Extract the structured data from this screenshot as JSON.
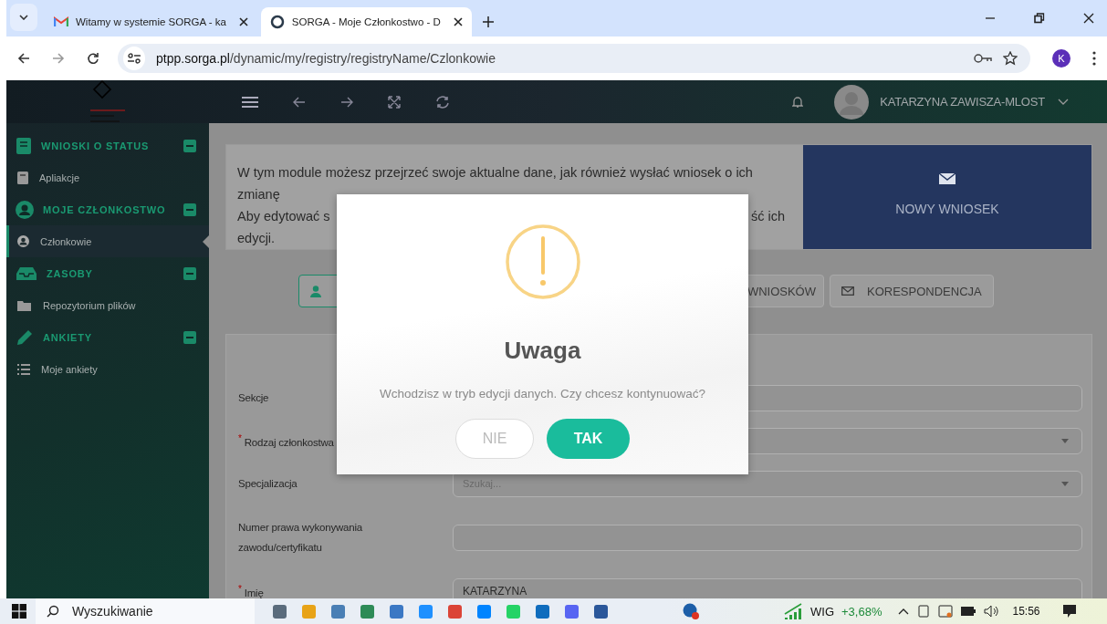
{
  "browser": {
    "tabs": [
      {
        "title": "Witamy w systemie SORGA - ka",
        "selected": false
      },
      {
        "title": "SORGA - Moje Członkostwo - D",
        "selected": true
      }
    ],
    "url_host": "ptpp.sorga.pl",
    "url_path": "/dynamic/my/registry/registryName/Czlonkowie",
    "profile_initial": "K"
  },
  "header": {
    "user_name": "KATARZYNA ZAWISZA-MLOST"
  },
  "sidebar": {
    "groups": [
      {
        "label": "WNIOSKI O STATUS",
        "expanded": true,
        "items": [
          {
            "label": "Apliakcje",
            "selected": false
          }
        ]
      },
      {
        "label": "MOJE CZŁONKOSTWO",
        "expanded": true,
        "items": [
          {
            "label": "Członkowie",
            "selected": true
          }
        ]
      },
      {
        "label": "ZASOBY",
        "expanded": true,
        "items": [
          {
            "label": "Repozytorium plików",
            "selected": false
          }
        ]
      },
      {
        "label": "ANKIETY",
        "expanded": true,
        "items": [
          {
            "label": "Moje ankiety",
            "selected": false
          }
        ]
      }
    ]
  },
  "info": {
    "text_1": "W tym module możesz przejrzeć swoje aktualne dane, jak również wysłać wniosek o ich zmianę",
    "text_2_start": "Aby edytować s",
    "text_2_end": "ść ich",
    "text_3": "edycji.",
    "button": "NOWY WNIOSEK"
  },
  "tabs": [
    {
      "selected": true
    },
    {
      "label": "WNIOSKÓW",
      "selected": false
    },
    {
      "label": "KORESPONDENCJA",
      "selected": false
    }
  ],
  "form": {
    "fields": [
      {
        "label": "Sekcje",
        "kind": "text"
      },
      {
        "label": "Rodzaj członkostwa",
        "required_mark": "*",
        "kind": "select"
      },
      {
        "label": "Specjalizacja",
        "kind": "select",
        "placeholder": "Szukaj..."
      },
      {
        "label": "Numer prawa wykonywania zawodu/certyfikatu",
        "kind": "text"
      },
      {
        "label": "Imię",
        "required_mark": "*",
        "kind": "text",
        "value": "KATARZYNA"
      }
    ]
  },
  "modal": {
    "title": "Uwaga",
    "message": "Wchodzisz w tryb edycji danych. Czy chcesz kontynuować?",
    "buttons": [
      {
        "label": "NIE",
        "kind": "cancel"
      },
      {
        "label": "TAK",
        "kind": "confirm"
      }
    ]
  },
  "taskbar": {
    "search_placeholder": "Wyszukiwanie",
    "stock_name": "WIG",
    "stock_change": "+3,68%",
    "time": "15:56"
  }
}
